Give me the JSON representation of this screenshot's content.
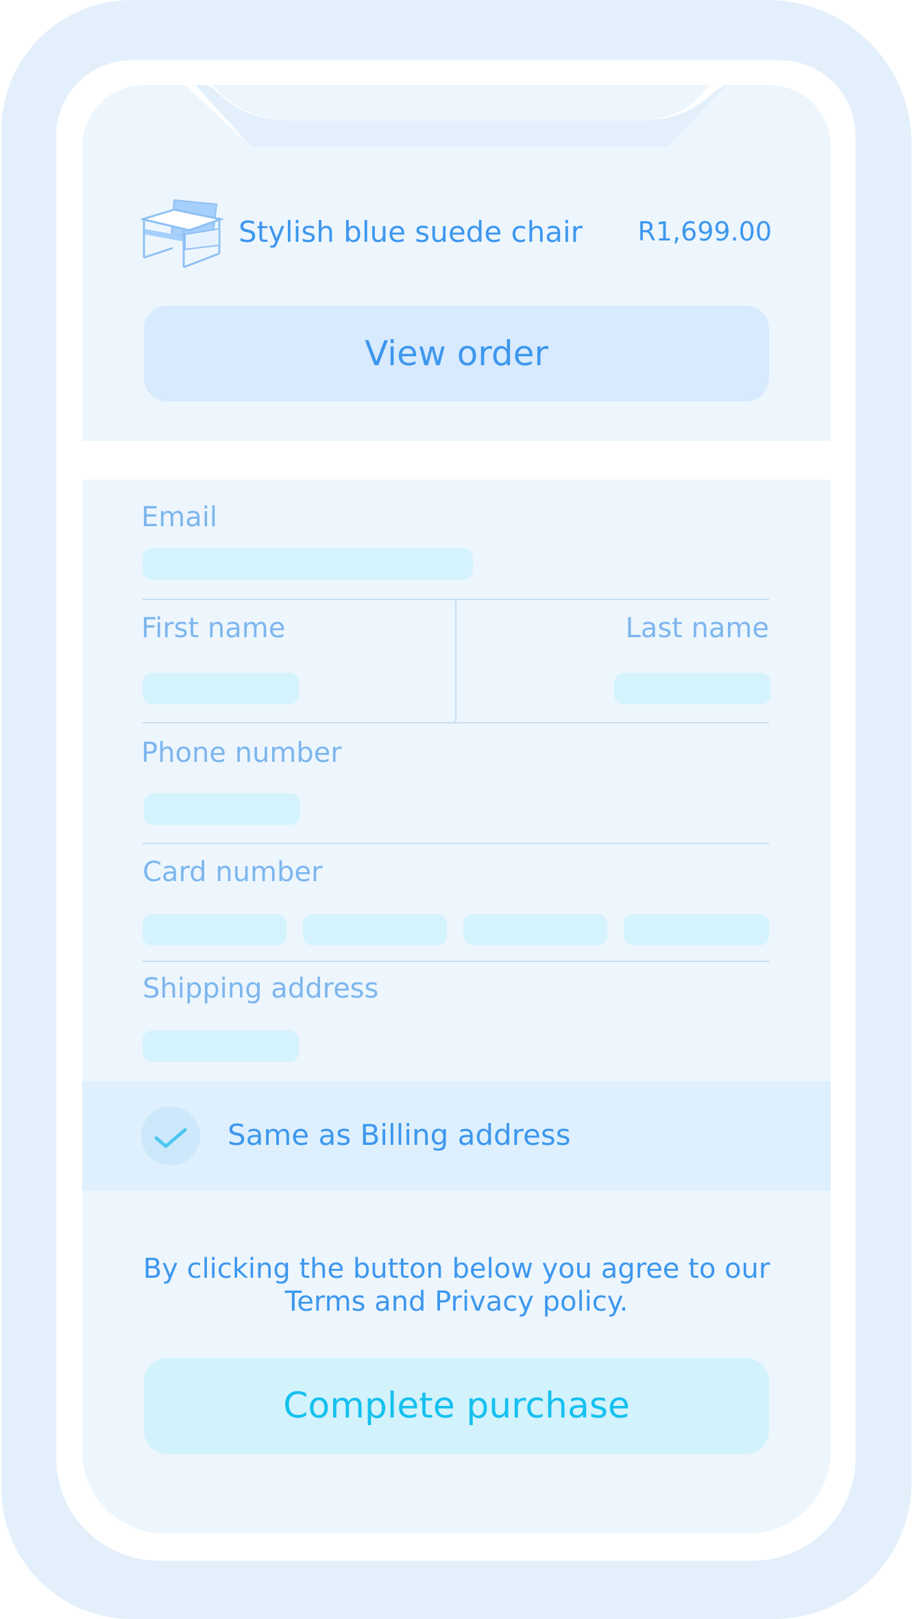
{
  "product": {
    "icon": "chair-icon",
    "name": "Stylish blue suede chair",
    "price": "R1,699.00"
  },
  "actions": {
    "view_order_label": "View order",
    "complete_label": "Complete purchase"
  },
  "form": {
    "email_label": "Email",
    "first_name_label": "First name",
    "last_name_label": "Last name",
    "phone_label": "Phone number",
    "card_label": "Card number",
    "shipping_label": "Shipping address",
    "billing_same_label": "Same as Billing address",
    "billing_same_checked": true
  },
  "terms": {
    "line1": "By clicking the button below you agree to our",
    "line2": "Terms and Privacy policy."
  },
  "colors": {
    "frame": "#e3f0fc",
    "screen": "#edf6fd",
    "text_primary": "#3d97ee",
    "label": "#7db6ee",
    "field": "#d4f3fd",
    "cta_text": "#14c0ef"
  }
}
